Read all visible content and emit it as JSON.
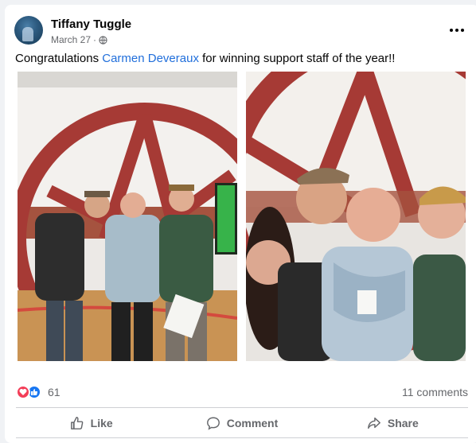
{
  "post": {
    "author": "Tiffany Tuggle",
    "date": "March 27",
    "separator": "·",
    "privacy_icon": "globe-icon",
    "caption_before": "Congratulations ",
    "mention": "Carmen Deveraux",
    "caption_after": " for winning support staff of the year!!"
  },
  "photos": [
    {
      "icon": "group-photo"
    },
    {
      "icon": "selfie-photo"
    }
  ],
  "engagement": {
    "reaction_icons": [
      "heart-icon",
      "like-icon"
    ],
    "reaction_count": "61",
    "comments": "11 comments"
  },
  "actions": {
    "like": "Like",
    "comment": "Comment",
    "share": "Share"
  },
  "colors": {
    "mention": "#216fdb",
    "heart": "#f33e58",
    "like": "#1877f2",
    "muted": "#65676b"
  }
}
